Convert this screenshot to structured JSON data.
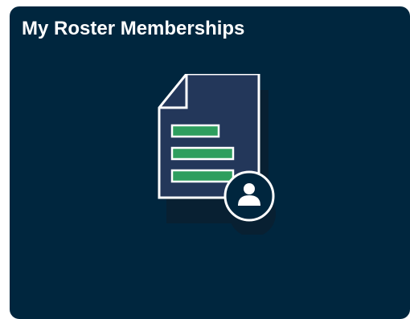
{
  "tile": {
    "title": "My Roster Memberships",
    "icon": "roster-document-person-icon"
  },
  "colors": {
    "tile_background": "#00263e",
    "document_fill": "#23375a",
    "document_stroke": "#ffffff",
    "bar_fill": "#2e9e5e",
    "avatar_fill": "#00263e",
    "shadow": "#0b1e2f"
  }
}
